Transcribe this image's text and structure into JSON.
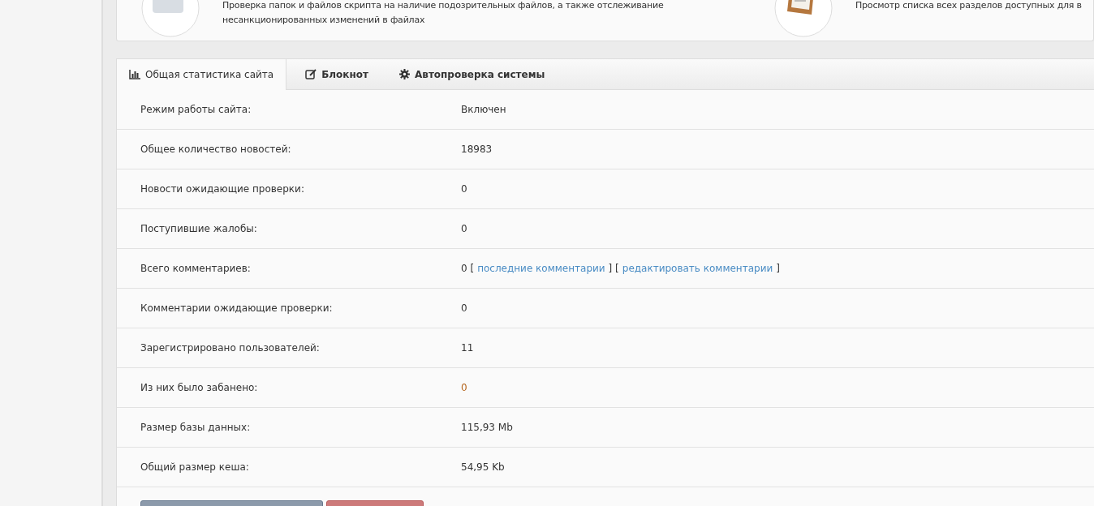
{
  "top_card": {
    "items": [
      {
        "description": [
          "Проверка папок и файлов скрипта на наличие подозрительных файлов, а также отслеживание",
          "несанкционированных изменений в файлах"
        ]
      },
      {
        "description": [
          "Просмотр списка всех разделов доступных для в"
        ]
      }
    ]
  },
  "tabs": [
    {
      "label": "Общая статистика сайта",
      "selected": true
    },
    {
      "label": "Блокнот",
      "selected": false
    },
    {
      "label": "Автопроверка системы",
      "selected": false
    }
  ],
  "stats": [
    {
      "label": "Режим работы сайта:",
      "value_parts": [
        {
          "kind": "text",
          "text": "Включен"
        }
      ]
    },
    {
      "label": "Общее количество новостей:",
      "value_parts": [
        {
          "kind": "text",
          "text": "18983"
        }
      ]
    },
    {
      "label": "Новости ожидающие проверки:",
      "value_parts": [
        {
          "kind": "text",
          "text": "0"
        }
      ]
    },
    {
      "label": "Поступившие жалобы:",
      "value_parts": [
        {
          "kind": "text",
          "text": "0"
        }
      ]
    },
    {
      "label": "Всего комментариев:",
      "value_parts": [
        {
          "kind": "text",
          "text": "0 ["
        },
        {
          "kind": "link",
          "text": "последние комментарии"
        },
        {
          "kind": "text",
          "text": "] ["
        },
        {
          "kind": "link",
          "text": "редактировать комментарии"
        },
        {
          "kind": "text",
          "text": "]"
        }
      ]
    },
    {
      "label": "Комментарии ожидающие проверки:",
      "value_parts": [
        {
          "kind": "text",
          "text": "0"
        }
      ]
    },
    {
      "label": "Зарегистрировано пользователей:",
      "value_parts": [
        {
          "kind": "text",
          "text": "11"
        }
      ]
    },
    {
      "label": "Из них было забанено:",
      "value_parts": [
        {
          "kind": "alert",
          "text": "0"
        }
      ]
    },
    {
      "label": "Размер базы данных:",
      "value_parts": [
        {
          "kind": "text",
          "text": "115,93 Mb"
        }
      ]
    },
    {
      "label": "Общий размер кеша:",
      "value_parts": [
        {
          "kind": "text",
          "text": "54,95 Kb"
        }
      ]
    }
  ],
  "buttons": [
    {
      "kind": "primary"
    },
    {
      "kind": "danger"
    }
  ]
}
